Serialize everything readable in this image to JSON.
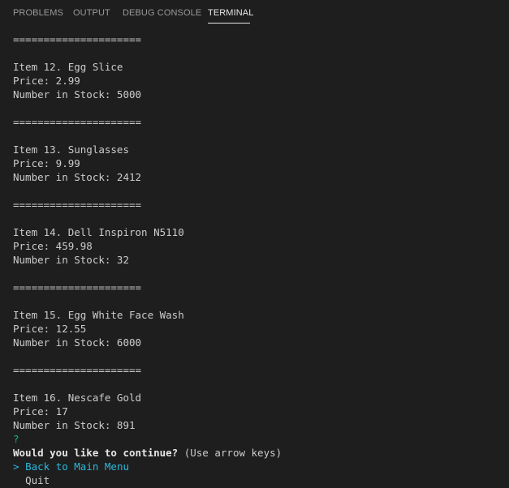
{
  "tabs": [
    {
      "label": "PROBLEMS"
    },
    {
      "label": "OUTPUT"
    },
    {
      "label": "DEBUG CONSOLE"
    },
    {
      "label": "TERMINAL"
    }
  ],
  "active_tab": "TERMINAL",
  "colors": {
    "background": "#1e1e1e",
    "text": "#cccccc",
    "prompt_question": "#0dbc79",
    "selected_choice": "#29b8db"
  },
  "terminal": {
    "separator": "=====================",
    "items": [
      {
        "title": "Item 12. Egg Slice",
        "price": "Price: 2.99",
        "stock": "Number in Stock: 5000"
      },
      {
        "title": "Item 13. Sunglasses",
        "price": "Price: 9.99",
        "stock": "Number in Stock: 2412"
      },
      {
        "title": "Item 14. Dell Inspiron N5110",
        "price": "Price: 459.98",
        "stock": "Number in Stock: 32"
      },
      {
        "title": "Item 15. Egg White Face Wash",
        "price": "Price: 12.55",
        "stock": "Number in Stock: 6000"
      },
      {
        "title": "Item 16. Nescafe Gold",
        "price": "Price: 17",
        "stock": "Number in Stock: 891"
      }
    ],
    "prompt": {
      "mark": "?",
      "question": "Would you like to continue?",
      "hint": "(Use arrow keys)",
      "choices": [
        {
          "pointer": ">",
          "label": "Back to Main Menu",
          "selected": true
        },
        {
          "pointer": " ",
          "label": "Quit",
          "selected": false
        }
      ]
    }
  }
}
